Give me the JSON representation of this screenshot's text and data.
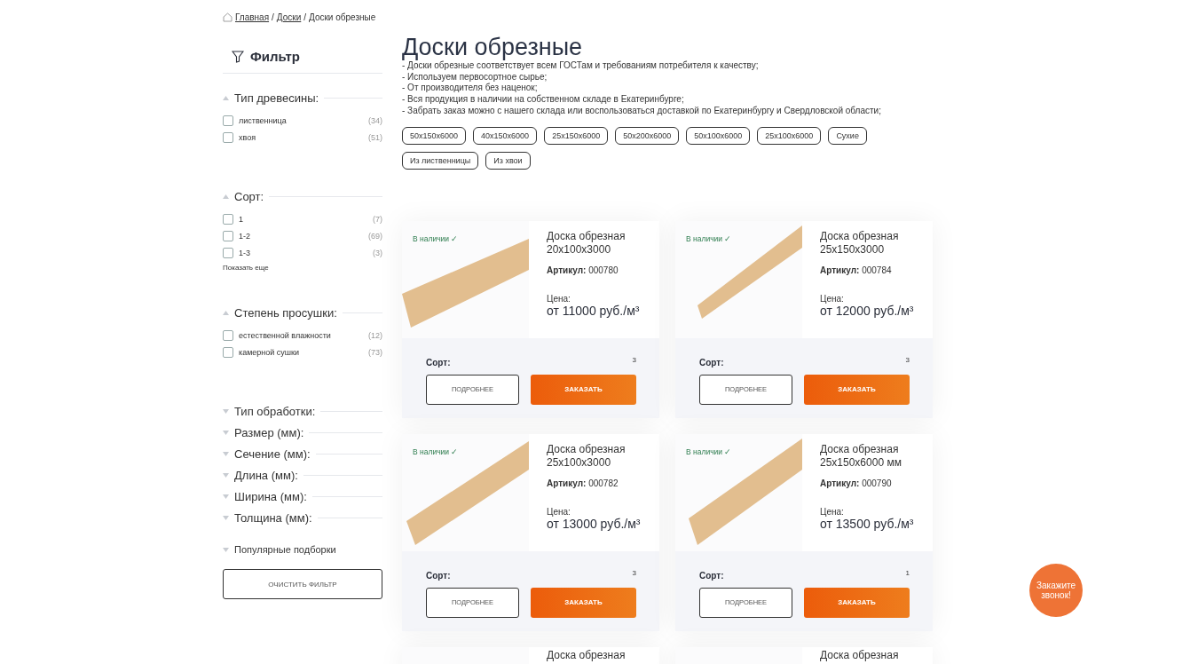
{
  "breadcrumb_separator": "/",
  "breadcrumbs": [
    {
      "label": "Главная",
      "link": true
    },
    {
      "label": "Доски",
      "link": true
    },
    {
      "label": "Доски обрезные",
      "link": false
    }
  ],
  "filter": {
    "title": "Фильтр",
    "groups": [
      {
        "title": "Тип древесины:",
        "expanded": true,
        "options": [
          {
            "label": "лиственница",
            "count": "(34)",
            "checked": false
          },
          {
            "label": "хвоя",
            "count": "(51)",
            "checked": false
          }
        ]
      },
      {
        "title": "Сорт:",
        "expanded": true,
        "options": [
          {
            "label": "1",
            "count": "(7)",
            "checked": false
          },
          {
            "label": "1-2",
            "count": "(69)",
            "checked": false
          },
          {
            "label": "1-3",
            "count": "(3)",
            "checked": false
          }
        ],
        "show_more": "Показать еще"
      },
      {
        "title": "Степень просушки:",
        "expanded": true,
        "options": [
          {
            "label": "естественной влажности",
            "count": "(12)",
            "checked": false
          },
          {
            "label": "камерной сушки",
            "count": "(73)",
            "checked": false
          }
        ]
      },
      {
        "title": "Тип обработки:",
        "expanded": false
      },
      {
        "title": "Размер (мм):",
        "expanded": false
      },
      {
        "title": "Сечение (мм):",
        "expanded": false
      },
      {
        "title": "Длина (мм):",
        "expanded": false
      },
      {
        "title": "Ширина (мм):",
        "expanded": false
      },
      {
        "title": "Толщина (мм):",
        "expanded": false
      }
    ],
    "popular": {
      "title": "Популярные подборки",
      "expanded": false
    },
    "clear_button": "ОЧИСТИТЬ ФИЛЬТР"
  },
  "page_title": "Доски обрезные",
  "description": [
    "- Доски обрезные соответствует всем ГОСТам и требованиям потребителя к качеству;",
    "- Используем первосортное сырье;",
    "- От производителя без наценок;",
    "- Вся продукция в наличии на собственном складе в Екатеринбурге;",
    "- Забрать заказ можно с нашего склада или воспользоваться доставкой по Екатеринбургу и Свердловской области;"
  ],
  "tags": [
    "50x150x6000",
    "40x150x6000",
    "25x150x6000",
    "50x200x6000",
    "50x100x6000",
    "25x100x6000",
    "Сухие",
    "Из лиственницы",
    "Из хвои"
  ],
  "products": [
    {
      "stock": "В наличии ✓",
      "title": "Доска обрезная 20x100x3000",
      "article_label": "Артикул:",
      "article": "000780",
      "price_label": "Цена:",
      "price": "от 11000 руб./м³",
      "grade_label": "Сорт:",
      "grade": "3",
      "details_button": "ПОДРОБНЕЕ",
      "order_button": "ЗАКАЗАТЬ"
    },
    {
      "stock": "В наличии ✓",
      "title": "Доска обрезная 25x150x3000",
      "article_label": "Артикул:",
      "article": "000784",
      "price_label": "Цена:",
      "price": "от 12000 руб./м³",
      "grade_label": "Сорт:",
      "grade": "3",
      "details_button": "ПОДРОБНЕЕ",
      "order_button": "ЗАКАЗАТЬ"
    },
    {
      "stock": "В наличии ✓",
      "title": "Доска обрезная 25x100x3000",
      "article_label": "Артикул:",
      "article": "000782",
      "price_label": "Цена:",
      "price": "от 13000 руб./м³",
      "grade_label": "Сорт:",
      "grade": "3",
      "details_button": "ПОДРОБНЕЕ",
      "order_button": "ЗАКАЗАТЬ"
    },
    {
      "stock": "В наличии ✓",
      "title": "Доска обрезная 25x150x6000 мм",
      "article_label": "Артикул:",
      "article": "000790",
      "price_label": "Цена:",
      "price": "от 13500 руб./м³",
      "grade_label": "Сорт:",
      "grade": "1",
      "details_button": "ПОДРОБНЕЕ",
      "order_button": "ЗАКАЗАТЬ"
    },
    {
      "title": "Доска обрезная"
    },
    {
      "title": "Доска обрезная"
    }
  ],
  "callback_button": "Закажите звонок!"
}
